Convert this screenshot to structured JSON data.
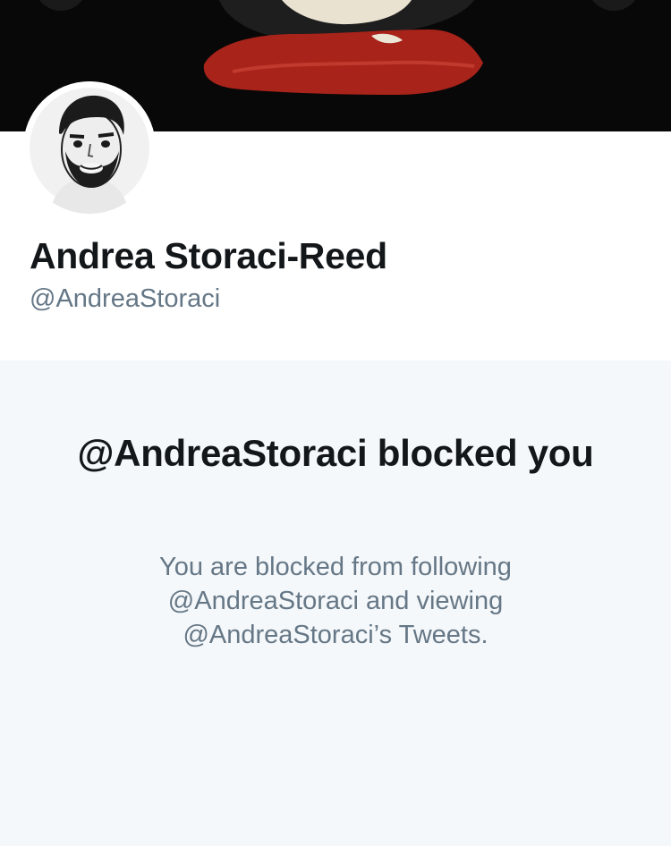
{
  "profile": {
    "display_name": "Andrea Storaci-Reed",
    "handle": "@AndreaStoraci"
  },
  "blocked": {
    "title": "@AndreaStoraci blocked you",
    "message": "You are blocked from following @AndreaStoraci and viewing @AndreaStoraci’s Tweets."
  },
  "colors": {
    "banner_background": "#080808",
    "lips": "#a8231a",
    "name_text": "#14171a",
    "secondary_text": "#657786",
    "page_background": "#f5f8fa",
    "card_background": "#ffffff"
  },
  "icons": {
    "avatar": "profile-avatar-image",
    "banner": "header-banner-image"
  }
}
